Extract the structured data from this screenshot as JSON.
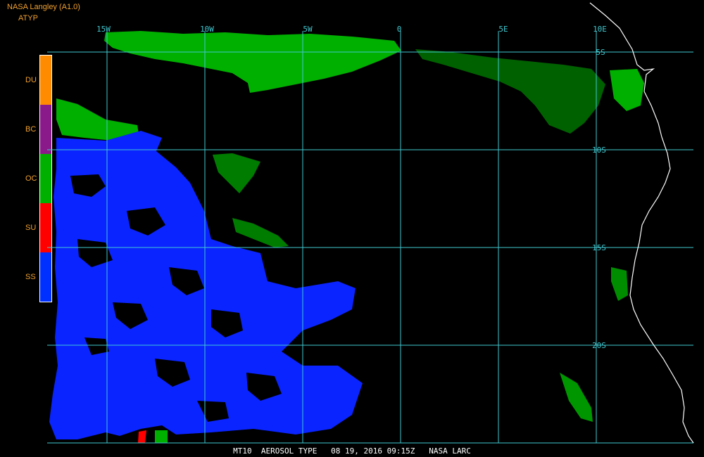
{
  "header": {
    "title": "NASA Langley (A1.0)",
    "product": "ATYP"
  },
  "legend": {
    "items": [
      {
        "label": "DU",
        "color": "#ff8c00"
      },
      {
        "label": "BC",
        "color": "#8a1a8a"
      },
      {
        "label": "OC",
        "color": "#00b000"
      },
      {
        "label": "SU",
        "color": "#ff0000"
      },
      {
        "label": "SS",
        "color": "#0030ff"
      }
    ]
  },
  "map": {
    "lon_labels": [
      "15W",
      "10W",
      "5W",
      "0",
      "5E",
      "10E"
    ],
    "lat_labels": [
      "5S",
      "10S",
      "15S",
      "20S"
    ],
    "grid_color": "#40c8d0",
    "coast_color": "#ffffff"
  },
  "footer": {
    "text": "MT10  AEROSOL TYPE   08 19, 2016 09:15Z   NASA LARC"
  }
}
